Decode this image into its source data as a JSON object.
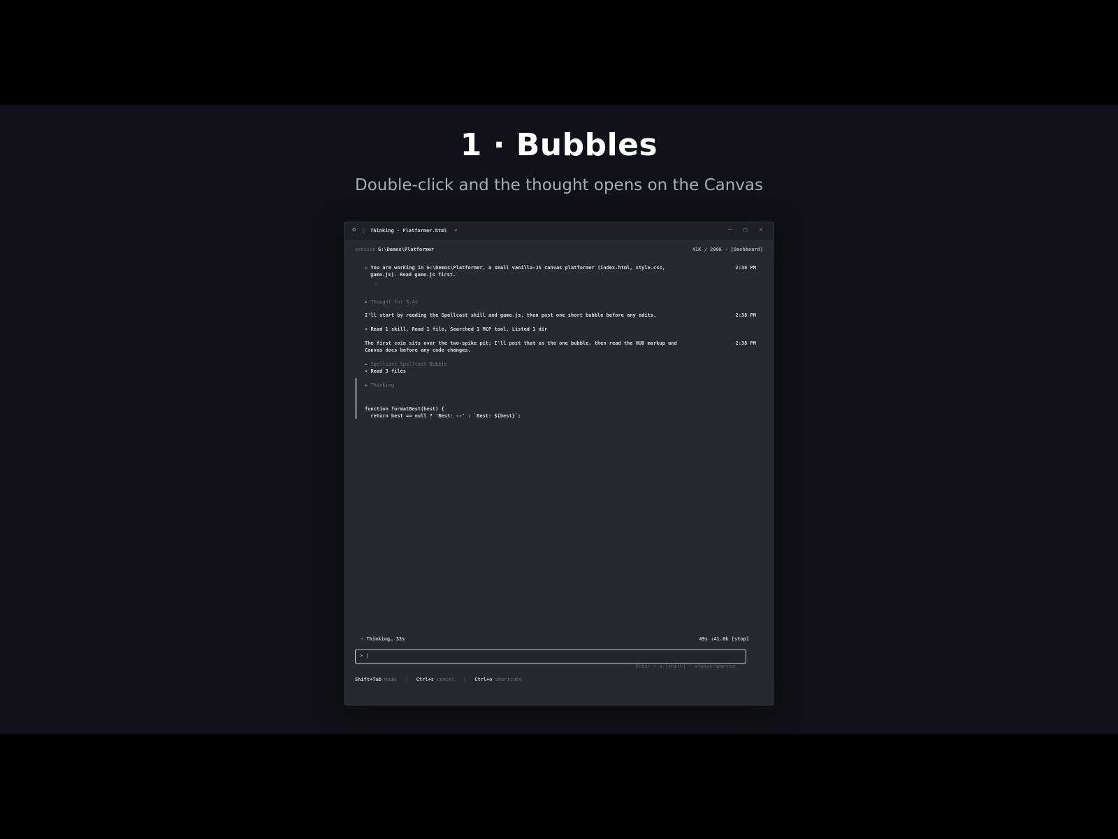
{
  "slide": {
    "title": "1 · Bubbles",
    "subtitle": "Double-click and the thought opens on the Canvas"
  },
  "window": {
    "tab_title": "Thinking · Platformer.html",
    "controls": {
      "new_tab": "+",
      "dropdown": "▾",
      "minimize": "—",
      "maximize": "▢",
      "close": "✕",
      "tab_close": "✕"
    },
    "icons": {
      "app": "app-icon",
      "tab": "spinner-icon"
    },
    "path_label": "session",
    "path": "G:\\Demos\\Platformer",
    "path_right": "41K / 200K · [Dashboard]"
  },
  "transcript": {
    "user_message_line1": "You are working in G:\\Demos\\Platformer, a small vanilla-JS canvas platformer (index.html, style.css,",
    "user_message_line2": "game.js). Read game.js first.",
    "user_message_time": "2:38 PM",
    "collapse_marker": "⌄",
    "thought_label": "Thought for 3.4s",
    "assistant_msg1": "I'll start by reading the Spellcast skill and game.js, then post one short bubble before any edits.",
    "assistant_msg1_time": "2:38 PM",
    "tools_summary": "Read 1 skill, Read 1 file, Searched 1 MCP tool, Listed 1 dir",
    "assistant_msg2_line1": "The first coin sits over the two-spike pit; I'll post that as the one bubble, then read the HUD markup and",
    "assistant_msg2_line2": "Canvas docs before any code changes.",
    "assistant_msg2_time": "2:38 PM",
    "spellcast_label": "Spellcast Spellcast Bubble",
    "read_files": "Read 3 files",
    "thinking_label": "Thinking",
    "code_line1": "function formatBest(best) {",
    "code_line2": "  return best == null ? 'Best: --' : `Best: ${best}`;"
  },
  "status": {
    "left": "◦ Thinking… 33s",
    "right": "49s  ↓41.0k  [stop]"
  },
  "input": {
    "prompt": "> |",
    "hint": "Enter ⏎ a [shift] · always-approve"
  },
  "footer": {
    "items": [
      {
        "key": "Shift+Tab",
        "desc": "mode"
      },
      {
        "key": "Ctrl+s",
        "desc": "cancel"
      },
      {
        "key": "Ctrl+o",
        "desc": "shortcuts"
      }
    ]
  },
  "colors": {
    "page_bg": "#000000",
    "frame_bg": "#0f1319",
    "window_bg": "#252a31",
    "text": "#d6dbe1",
    "dim_text": "#6e757e"
  }
}
